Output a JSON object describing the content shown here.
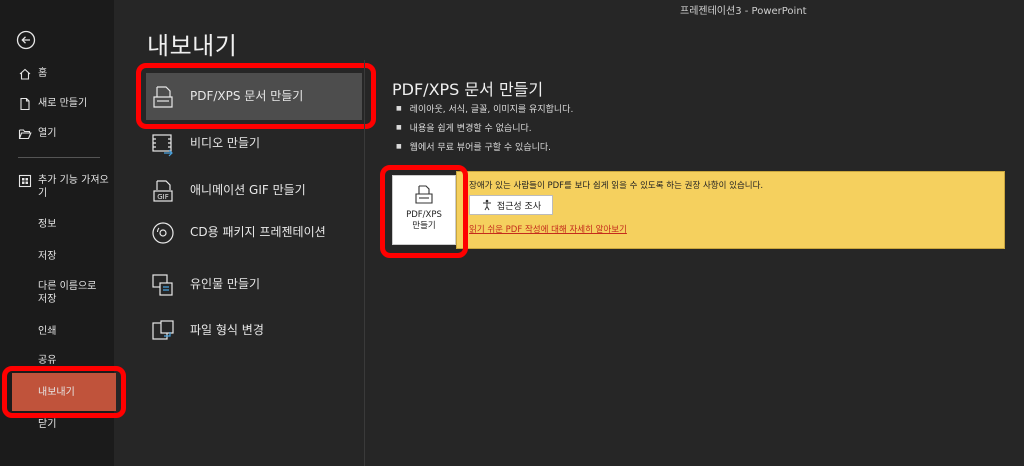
{
  "window": {
    "title": "프레젠테이션3  -  PowerPoint"
  },
  "nav": {
    "items": [
      {
        "label": "홈",
        "icon": "home-icon"
      },
      {
        "label": "새로 만들기",
        "icon": "new-document-icon"
      },
      {
        "label": "열기",
        "icon": "folder-open-icon"
      },
      {
        "label": "추가 기능 가져오기",
        "icon": "add-ins-icon"
      }
    ],
    "plain": [
      "정보",
      "저장",
      "다른 이름으로 저장",
      "인쇄",
      "공유",
      "내보내기",
      "닫기"
    ],
    "active": "내보내기"
  },
  "main": {
    "title": "내보내기",
    "options": [
      {
        "label": "PDF/XPS 문서 만들기",
        "icon": "pdf-document-icon"
      },
      {
        "label": "비디오 만들기",
        "icon": "video-icon"
      },
      {
        "label": "애니메이션 GIF 만들기",
        "icon": "gif-icon"
      },
      {
        "label": "CD용 패키지 프레젠테이션",
        "icon": "cd-icon"
      },
      {
        "label": "유인물 만들기",
        "icon": "handout-icon"
      },
      {
        "label": "파일 형식 변경",
        "icon": "change-file-type-icon"
      }
    ]
  },
  "panel": {
    "title": "PDF/XPS 문서 만들기",
    "bullets": [
      "레이아웃, 서식, 글꼴, 이미지를 유지합니다.",
      "내용을 쉽게 변경할 수 없습니다.",
      "웹에서 무료 뷰어를 구할 수 있습니다."
    ],
    "notice": "장애가 있는 사람들이 PDF를 보다 쉽게 읽을 수 있도록 하는 권장 사항이 있습니다.",
    "accessibility_button": "접근성 조사",
    "link": "읽기 쉬운 PDF 작성에 대해 자세히 알아보기",
    "create_button": "PDF/XPS 만들기"
  },
  "colors": {
    "active_nav": "#c0533b",
    "highlight": "#ff0000",
    "notice_bg": "#f5d05e"
  }
}
